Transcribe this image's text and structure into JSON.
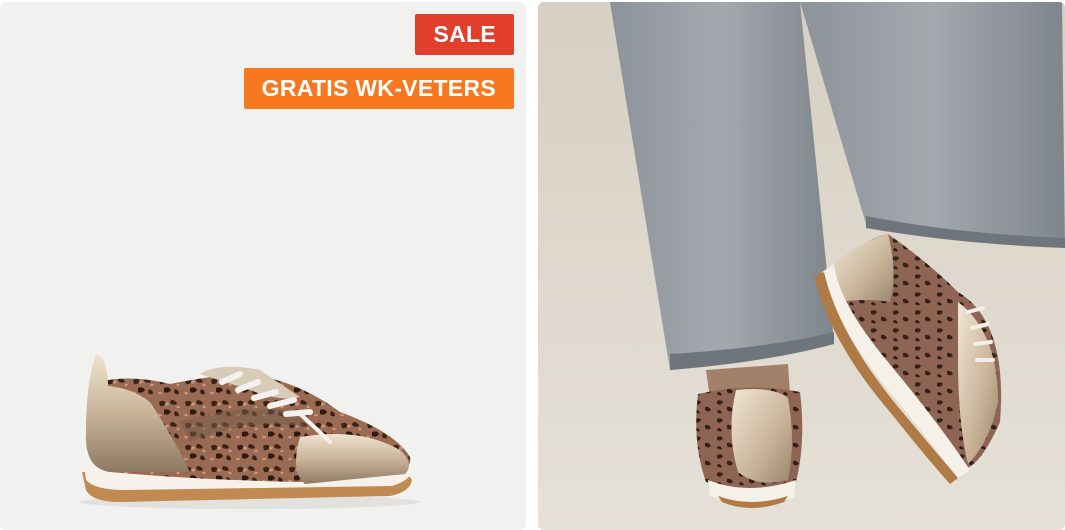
{
  "badges": {
    "sale": "SALE",
    "promo": "GRATIS WK-VETERS"
  },
  "colors": {
    "sale_badge": "#e23e2c",
    "promo_badge": "#f7781f",
    "product_bg": "#f1f1f0",
    "lifestyle_bg": "#d9d2c6"
  },
  "images": {
    "product": "leopard-print-sneaker-product-photo",
    "lifestyle": "leopard-print-sneakers-worn-with-grey-jeans"
  }
}
